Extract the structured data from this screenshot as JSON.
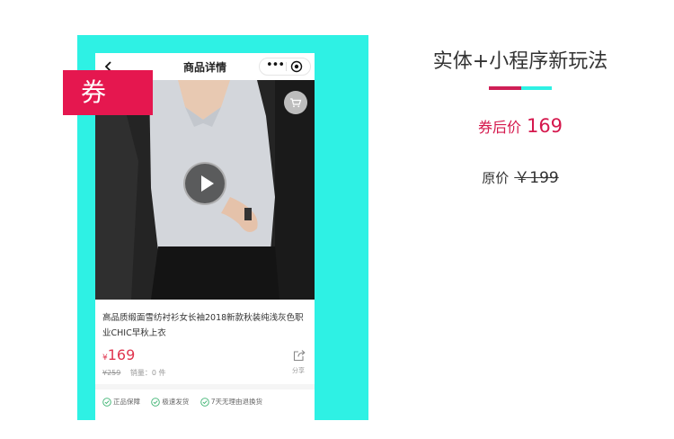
{
  "navbar": {
    "title": "商品详情",
    "more_glyph": "•••"
  },
  "coupon_tag": "券",
  "product": {
    "title": "高品质缎面雪纺衬衫女长袖2018新款秋装纯浅灰色职业CHIC早秋上衣",
    "currency_symbol": "¥",
    "price": "169",
    "original_price": "¥259",
    "sales_label": "销量：0 件",
    "share_label": "分享",
    "image_count": 4,
    "active_image": 0
  },
  "guarantees": [
    "正品保障",
    "极速发货",
    "7天无理由退换货"
  ],
  "promo": {
    "headline": "实体+小程序新玩法",
    "after_coupon_label": "券后价",
    "after_coupon_price": "169",
    "original_label": "原价",
    "original_price": "￥199"
  },
  "colors": {
    "accent_red": "#e5174f",
    "accent_cyan": "#2ef1e4",
    "price_red": "#e0354f",
    "check_green": "#3cb371"
  },
  "icons": [
    "back-arrow-icon",
    "more-icon",
    "close-circle-icon",
    "cart-icon",
    "play-icon",
    "share-icon",
    "check-circle-icon"
  ]
}
